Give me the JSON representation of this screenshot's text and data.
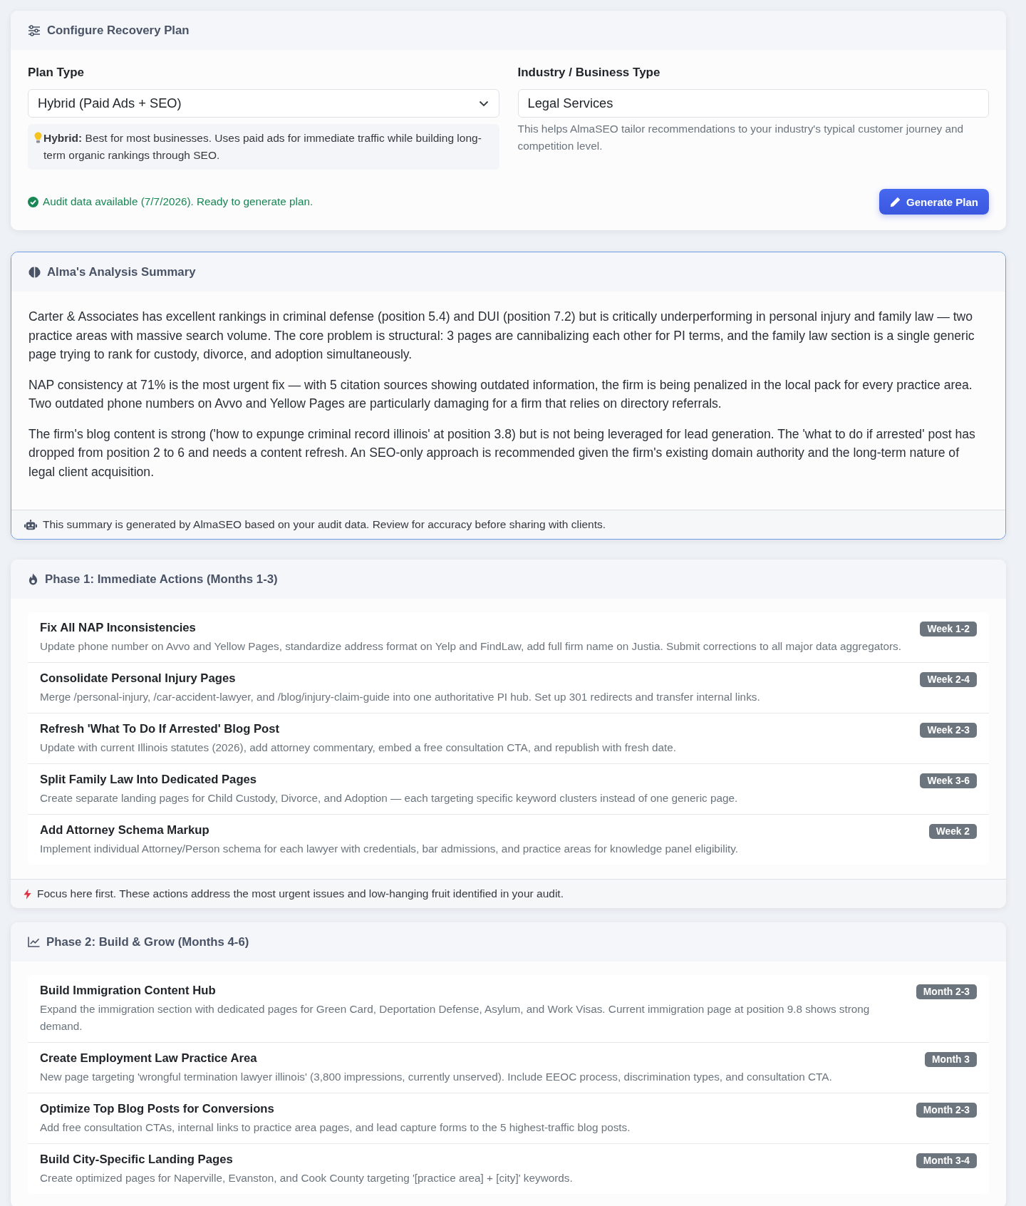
{
  "config": {
    "title": "Configure Recovery Plan",
    "plan_type": {
      "label": "Plan Type",
      "value": "Hybrid (Paid Ads + SEO)",
      "hint": "**Hybrid:** Best for most businesses. Uses paid ads for immediate traffic while building long-term organic rankings through SEO."
    },
    "industry": {
      "label": "Industry / Business Type",
      "value": "Legal Services",
      "help": "This helps AlmaSEO tailor recommendations to your industry's typical customer journey and competition level."
    },
    "status": "Audit data available (7/7/2026). Ready to generate plan.",
    "button": "Generate Plan"
  },
  "summary": {
    "title": "Alma's Analysis Summary",
    "paragraphs": [
      "Carter & Associates has excellent rankings in criminal defense (position 5.4) and DUI (position 7.2) but is critically underperforming in personal injury and family law — two practice areas with massive search volume. The core problem is structural: 3 pages are cannibalizing each other for PI terms, and the family law section is a single generic page trying to rank for custody, divorce, and adoption simultaneously.",
      "NAP consistency at 71% is the most urgent fix — with 5 citation sources showing outdated information, the firm is being penalized in the local pack for every practice area. Two outdated phone numbers on Avvo and Yellow Pages are particularly damaging for a firm that relies on directory referrals.",
      "The firm's blog content is strong ('how to expunge criminal record illinois' at position 3.8) but is not being leveraged for lead generation. The 'what to do if arrested' post has dropped from position 2 to 6 and needs a content refresh. An SEO-only approach is recommended given the firm's existing domain authority and the long-term nature of legal client acquisition."
    ],
    "footer": "This summary is generated by AlmaSEO based on your audit data. Review for accuracy before sharing with clients."
  },
  "phases": [
    {
      "title": "Phase 1: Immediate Actions (Months 1-3)",
      "items": [
        {
          "title": "Fix All NAP Inconsistencies",
          "description": "Update phone number on Avvo and Yellow Pages, standardize address format on Yelp and FindLaw, add full firm name on Justia. Submit corrections to all major data aggregators.",
          "timing": "Week 1-2"
        },
        {
          "title": "Consolidate Personal Injury Pages",
          "description": "Merge /personal-injury, /car-accident-lawyer, and /blog/injury-claim-guide into one authoritative PI hub. Set up 301 redirects and transfer internal links.",
          "timing": "Week 2-4"
        },
        {
          "title": "Refresh 'What To Do If Arrested' Blog Post",
          "description": "Update with current Illinois statutes (2026), add attorney commentary, embed a free consultation CTA, and republish with fresh date.",
          "timing": "Week 2-3"
        },
        {
          "title": "Split Family Law Into Dedicated Pages",
          "description": "Create separate landing pages for Child Custody, Divorce, and Adoption — each targeting specific keyword clusters instead of one generic page.",
          "timing": "Week 3-6"
        },
        {
          "title": "Add Attorney Schema Markup",
          "description": "Implement individual Attorney/Person schema for each lawyer with credentials, bar admissions, and practice areas for knowledge panel eligibility.",
          "timing": "Week 2"
        }
      ],
      "footer": "Focus here first. These actions address the most urgent issues and low-hanging fruit identified in your audit."
    },
    {
      "title": "Phase 2: Build & Grow (Months 4-6)",
      "items": [
        {
          "title": "Build Immigration Content Hub",
          "description": "Expand the immigration section with dedicated pages for Green Card, Deportation Defense, Asylum, and Work Visas. Current immigration page at position 9.8 shows strong demand.",
          "timing": "Month 2-3"
        },
        {
          "title": "Create Employment Law Practice Area",
          "description": "New page targeting 'wrongful termination lawyer illinois' (3,800 impressions, currently unserved). Include EEOC process, discrimination types, and consultation CTA.",
          "timing": "Month 3"
        },
        {
          "title": "Optimize Top Blog Posts for Conversions",
          "description": "Add free consultation CTAs, internal links to practice area pages, and lead capture forms to the 5 highest-traffic blog posts.",
          "timing": "Month 2-3"
        },
        {
          "title": "Build City-Specific Landing Pages",
          "description": "Create optimized pages for Naperville, Evanston, and Cook County targeting '[practice area] + [city]' keywords.",
          "timing": "Month 3-4"
        }
      ]
    }
  ]
}
